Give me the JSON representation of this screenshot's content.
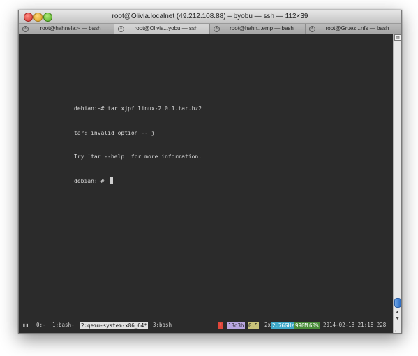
{
  "window": {
    "title": "root@Olivia.localnet (49.212.108.88) – byobu — ssh — 112×39"
  },
  "tabs": [
    {
      "label": "root@hahnela:~ — bash",
      "active": false
    },
    {
      "label": "root@Olivia...yobu — ssh",
      "active": true
    },
    {
      "label": "root@hahn...emp — bash",
      "active": false
    },
    {
      "label": "root@Gruez...nfs — bash",
      "active": false
    }
  ],
  "terminal": {
    "lines": [
      "debian:~# tar xjpf linux-2.0.1.tar.bz2",
      "tar: invalid option -- j",
      "Try `tar --help' for more information.",
      "debian:~# "
    ]
  },
  "status": {
    "pause_icon": "pause-icon",
    "win0": "0:-",
    "win1": "1:bash-",
    "win2": "2:qemu-system-x86_64*",
    "win3": "3:bash",
    "flag": "!",
    "uptime": "13d3h",
    "load": "0.5",
    "cpu_count": "2x",
    "cpu_freq": "2.76GHz",
    "mem": "990M",
    "mem_pct": "60%",
    "datetime": "2014-02-18 21:18:228",
    "colors": {
      "flag_bg": "#e0463a",
      "uptime_bg": "#b9a6e0",
      "load_bg": "#c9c37a",
      "freq_bg": "#3fa9c9",
      "mem_bg": "#4a8d3a"
    }
  }
}
